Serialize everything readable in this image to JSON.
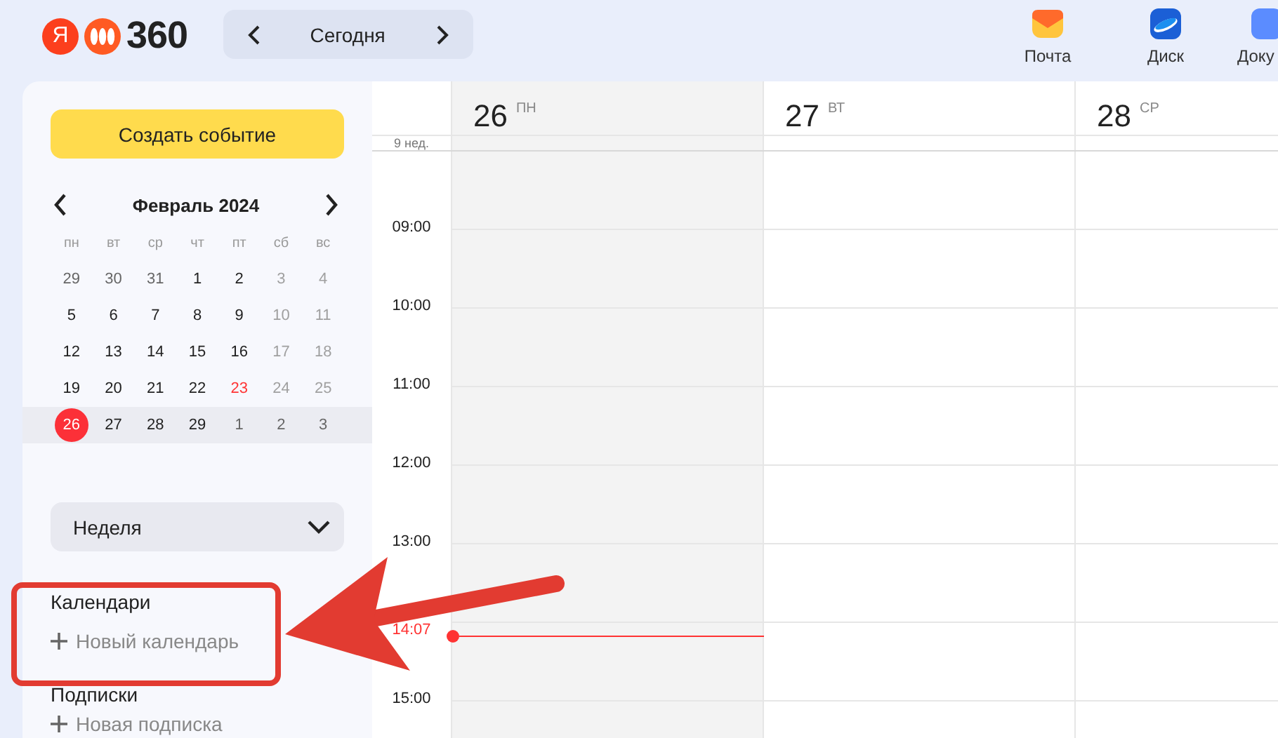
{
  "logo": {
    "letter": "Я",
    "text": "360"
  },
  "nav": {
    "label": "Сегодня"
  },
  "apps": [
    {
      "kind": "mail",
      "label": "Почта"
    },
    {
      "kind": "disk",
      "label": "Диск"
    },
    {
      "kind": "docs",
      "label": "Доку"
    }
  ],
  "sidebar": {
    "create_button": "Создать событие",
    "mini_calendar": {
      "title": "Февраль 2024",
      "weekdays": [
        "пн",
        "вт",
        "ср",
        "чт",
        "пт",
        "сб",
        "вс"
      ],
      "weeks": [
        {
          "days": [
            {
              "label": "29",
              "kind": "outside",
              "selected": false
            },
            {
              "label": "30",
              "kind": "outside",
              "selected": false
            },
            {
              "label": "31",
              "kind": "outside",
              "selected": false
            },
            {
              "label": "1",
              "kind": "normal",
              "selected": false
            },
            {
              "label": "2",
              "kind": "normal",
              "selected": false
            },
            {
              "label": "3",
              "kind": "weekend",
              "selected": false
            },
            {
              "label": "4",
              "kind": "weekend",
              "selected": false
            }
          ]
        },
        {
          "days": [
            {
              "label": "5",
              "kind": "normal",
              "selected": false
            },
            {
              "label": "6",
              "kind": "normal",
              "selected": false
            },
            {
              "label": "7",
              "kind": "normal",
              "selected": false
            },
            {
              "label": "8",
              "kind": "normal",
              "selected": false
            },
            {
              "label": "9",
              "kind": "normal",
              "selected": false
            },
            {
              "label": "10",
              "kind": "weekend",
              "selected": false
            },
            {
              "label": "11",
              "kind": "weekend",
              "selected": false
            }
          ]
        },
        {
          "days": [
            {
              "label": "12",
              "kind": "normal",
              "selected": false
            },
            {
              "label": "13",
              "kind": "normal",
              "selected": false
            },
            {
              "label": "14",
              "kind": "normal",
              "selected": false
            },
            {
              "label": "15",
              "kind": "normal",
              "selected": false
            },
            {
              "label": "16",
              "kind": "normal",
              "selected": false
            },
            {
              "label": "17",
              "kind": "weekend",
              "selected": false
            },
            {
              "label": "18",
              "kind": "weekend",
              "selected": false
            }
          ]
        },
        {
          "days": [
            {
              "label": "19",
              "kind": "normal",
              "selected": false
            },
            {
              "label": "20",
              "kind": "normal",
              "selected": false
            },
            {
              "label": "21",
              "kind": "normal",
              "selected": false
            },
            {
              "label": "22",
              "kind": "normal",
              "selected": false
            },
            {
              "label": "23",
              "kind": "holiday",
              "selected": false
            },
            {
              "label": "24",
              "kind": "weekend",
              "selected": false
            },
            {
              "label": "25",
              "kind": "weekend",
              "selected": false
            }
          ]
        },
        {
          "days": [
            {
              "label": "26",
              "kind": "normal",
              "selected": true
            },
            {
              "label": "27",
              "kind": "normal",
              "selected": false
            },
            {
              "label": "28",
              "kind": "normal",
              "selected": false
            },
            {
              "label": "29",
              "kind": "normal",
              "selected": false
            },
            {
              "label": "1",
              "kind": "outside",
              "selected": false
            },
            {
              "label": "2",
              "kind": "outside",
              "selected": false
            },
            {
              "label": "3",
              "kind": "outside",
              "selected": false
            }
          ]
        }
      ]
    },
    "view_select": "Неделя",
    "sections": [
      {
        "title": "Календари",
        "add": "Новый календарь"
      },
      {
        "title": "Подписки",
        "add": "Новая подписка"
      }
    ]
  },
  "week_label": "9 нед.",
  "days": [
    {
      "number": "26",
      "weekday": "ПН",
      "selected": true
    },
    {
      "number": "27",
      "weekday": "ВТ",
      "selected": false
    },
    {
      "number": "28",
      "weekday": "СР",
      "selected": false
    }
  ],
  "hours": [
    {
      "kind": "hour",
      "label": "09:00"
    },
    {
      "kind": "hour",
      "label": "10:00"
    },
    {
      "kind": "hour",
      "label": "11:00"
    },
    {
      "kind": "hour",
      "label": "12:00"
    },
    {
      "kind": "hour",
      "label": "13:00"
    },
    {
      "kind": "now",
      "label": "14:07"
    },
    {
      "kind": "hour",
      "label": "15:00"
    }
  ]
}
